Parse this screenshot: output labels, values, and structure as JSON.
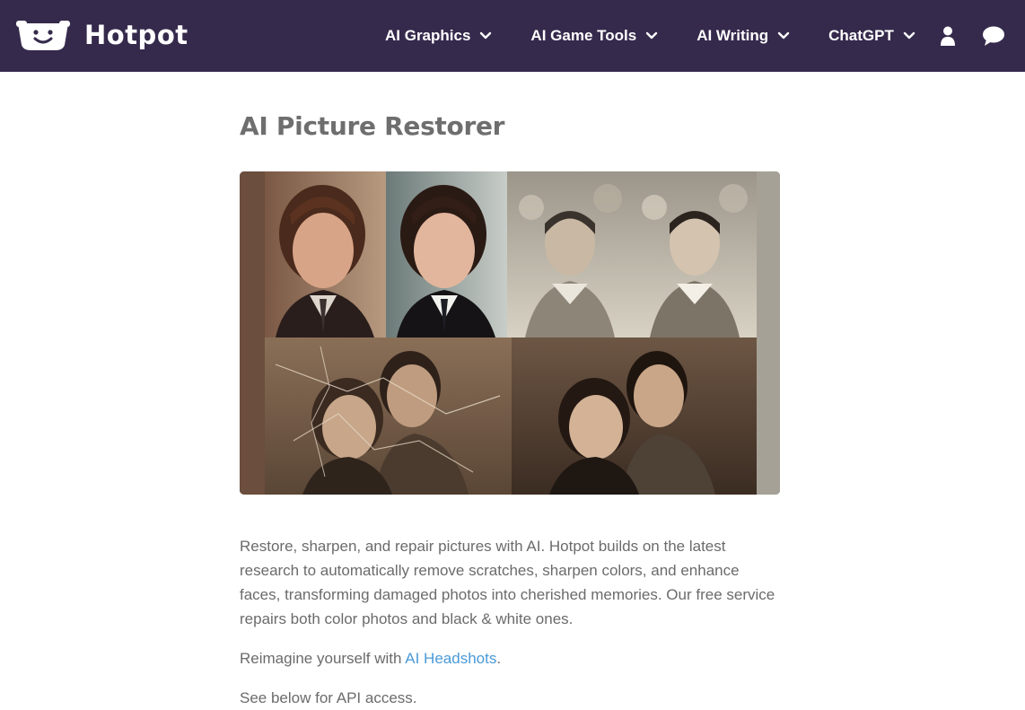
{
  "brand": {
    "name": "Hotpot",
    "logo_icon": "smiling-pot-logo"
  },
  "nav": {
    "items": [
      {
        "label": "AI Graphics",
        "icon": "chevron-down-icon"
      },
      {
        "label": "AI Game Tools",
        "icon": "chevron-down-icon"
      },
      {
        "label": "AI Writing",
        "icon": "chevron-down-icon"
      },
      {
        "label": "ChatGPT",
        "icon": "chevron-down-icon"
      }
    ],
    "user_icon": "user-icon",
    "chat_icon": "chat-bubble-icon"
  },
  "page": {
    "title": "AI Picture Restorer",
    "description": "Restore, sharpen, and repair pictures with AI. Hotpot builds on the latest research to automatically remove scratches, sharpen colors, and enhance faces, transforming damaged photos into cherished memories. Our free service repairs both color photos and black & white ones.",
    "reimagine_prefix": "Reimagine yourself with ",
    "reimagine_link": "AI Headshots",
    "reimagine_suffix": ".",
    "api_note": "See below for API access."
  },
  "colors": {
    "header_bg": "#352a4c",
    "link": "#4a9ad8",
    "title": "#6e6e6e",
    "body_text": "#6b6b6b"
  }
}
